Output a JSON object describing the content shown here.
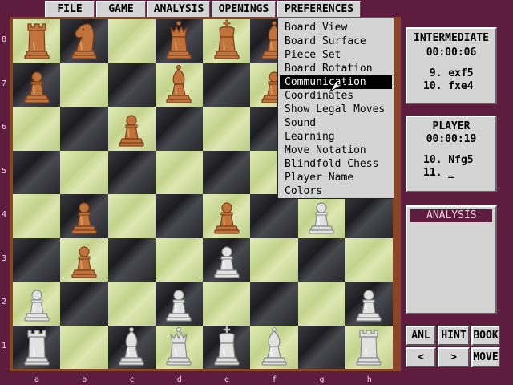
{
  "menubar": {
    "file": "FILE",
    "game": "GAME",
    "analysis": "ANALYSIS",
    "openings": "OPENINGS",
    "preferences": "PREFERENCES"
  },
  "preferences_menu": {
    "items": [
      "Board View",
      "Board Surface",
      "Piece Set",
      "Board Rotation",
      "Communication",
      "Coordinates",
      "Show Legal Moves",
      "Sound",
      "Learning",
      "Move Notation",
      "Blindfold Chess",
      "Player Name",
      "Colors"
    ],
    "selected": "Communication"
  },
  "board": {
    "files": [
      "a",
      "b",
      "c",
      "d",
      "e",
      "f",
      "g",
      "h"
    ],
    "ranks": [
      "8",
      "7",
      "6",
      "5",
      "4",
      "3",
      "2",
      "1"
    ],
    "light_color": "#d6e0a4",
    "dark_color": "#2c2c30",
    "pieces": [
      {
        "square": "a8",
        "type": "rook",
        "color": "black"
      },
      {
        "square": "b8",
        "type": "knight",
        "color": "black"
      },
      {
        "square": "d8",
        "type": "queen",
        "color": "black"
      },
      {
        "square": "e8",
        "type": "king",
        "color": "black"
      },
      {
        "square": "f8",
        "type": "bishop",
        "color": "black"
      },
      {
        "square": "a7",
        "type": "pawn",
        "color": "black"
      },
      {
        "square": "d7",
        "type": "bishop",
        "color": "black"
      },
      {
        "square": "f7",
        "type": "pawn",
        "color": "black"
      },
      {
        "square": "c6",
        "type": "pawn",
        "color": "black"
      },
      {
        "square": "b4",
        "type": "pawn",
        "color": "black"
      },
      {
        "square": "e4",
        "type": "pawn",
        "color": "black"
      },
      {
        "square": "g4",
        "type": "pawn",
        "color": "white"
      },
      {
        "square": "b3",
        "type": "pawn",
        "color": "black"
      },
      {
        "square": "e3",
        "type": "pawn",
        "color": "white"
      },
      {
        "square": "a2",
        "type": "pawn",
        "color": "white"
      },
      {
        "square": "d2",
        "type": "pawn",
        "color": "white"
      },
      {
        "square": "h2",
        "type": "pawn",
        "color": "white"
      },
      {
        "square": "a1",
        "type": "rook",
        "color": "white"
      },
      {
        "square": "c1",
        "type": "bishop",
        "color": "white"
      },
      {
        "square": "d1",
        "type": "queen",
        "color": "white"
      },
      {
        "square": "e1",
        "type": "king",
        "color": "white"
      },
      {
        "square": "f1",
        "type": "bishop",
        "color": "white"
      },
      {
        "square": "h1",
        "type": "rook",
        "color": "white"
      }
    ]
  },
  "opponent_panel": {
    "name": "INTERMEDIATE",
    "clock": "00:00:06",
    "moves": [
      " 9. exf5",
      "10. fxe4"
    ]
  },
  "player_panel": {
    "name": "PLAYER",
    "clock": "00:00:19",
    "moves": [
      "10. Nfg5",
      "11. _"
    ]
  },
  "analysis_panel": {
    "title": "ANALYSIS"
  },
  "buttons": {
    "anl": "ANL",
    "hint": "HINT",
    "book": "BOOK",
    "back": "<",
    "forward": ">",
    "move": "MOVE"
  },
  "colors": {
    "background": "#5e1d3f",
    "frame": "#8a4628",
    "menu_bg": "#d4d4d4",
    "black_piece": "#b8703a",
    "white_piece": "#d8d8d8"
  }
}
